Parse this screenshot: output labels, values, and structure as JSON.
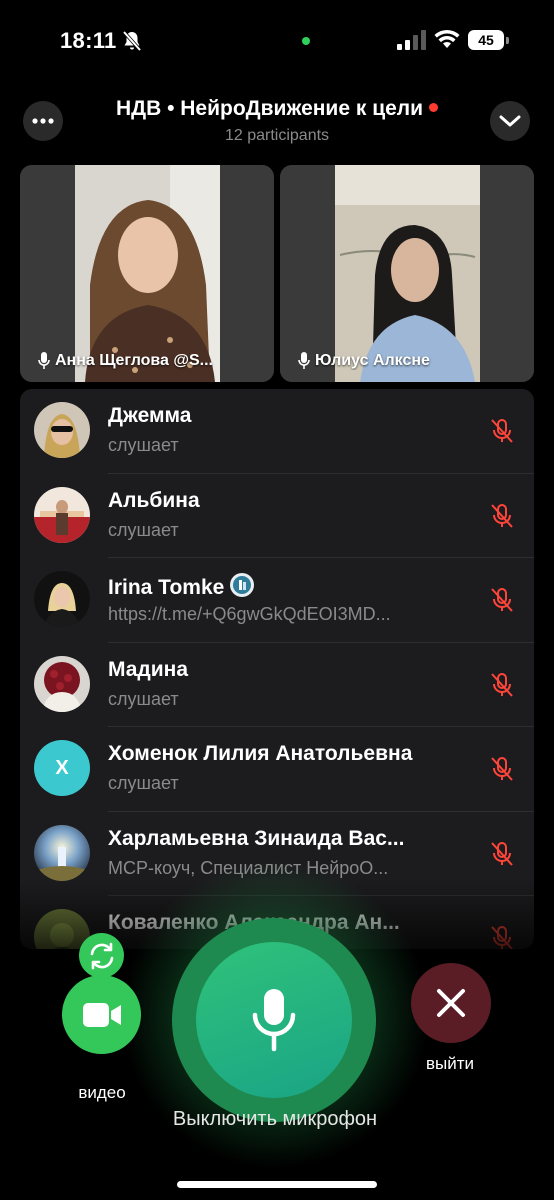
{
  "status_bar": {
    "time": "18:11",
    "battery": "45"
  },
  "header": {
    "title": "НДВ • НейроДвижение к цели",
    "participants": "12 participants"
  },
  "video_tiles": [
    {
      "name": "Анна Щеглова @S..."
    },
    {
      "name": "Юлиус Алксне"
    }
  ],
  "participants": [
    {
      "name": "Джемма",
      "status": "слушает"
    },
    {
      "name": "Альбина",
      "status": "слушает"
    },
    {
      "name": "Irina Tomke",
      "status": "https://t.me/+Q6gwGkQdEOI3MD..."
    },
    {
      "name": "Мадина",
      "status": "слушает"
    },
    {
      "name": "Хоменок Лилия Анатольевна",
      "status": "слушает",
      "initial": "Х"
    },
    {
      "name": "Харламьевна Зинаида Вас...",
      "status": "МСР-коуч, Специалист НейроО..."
    },
    {
      "name": "Коваленко Александра Ан...",
      "status": ""
    }
  ],
  "controls": {
    "video_label": "видео",
    "mic_label": "Выключить микрофон",
    "leave_label": "выйти"
  },
  "colors": {
    "accent_green": "#34c759",
    "mute_red": "#ff453a",
    "leave_bg": "#5a1d26",
    "list_bg": "#1c1c1e"
  }
}
